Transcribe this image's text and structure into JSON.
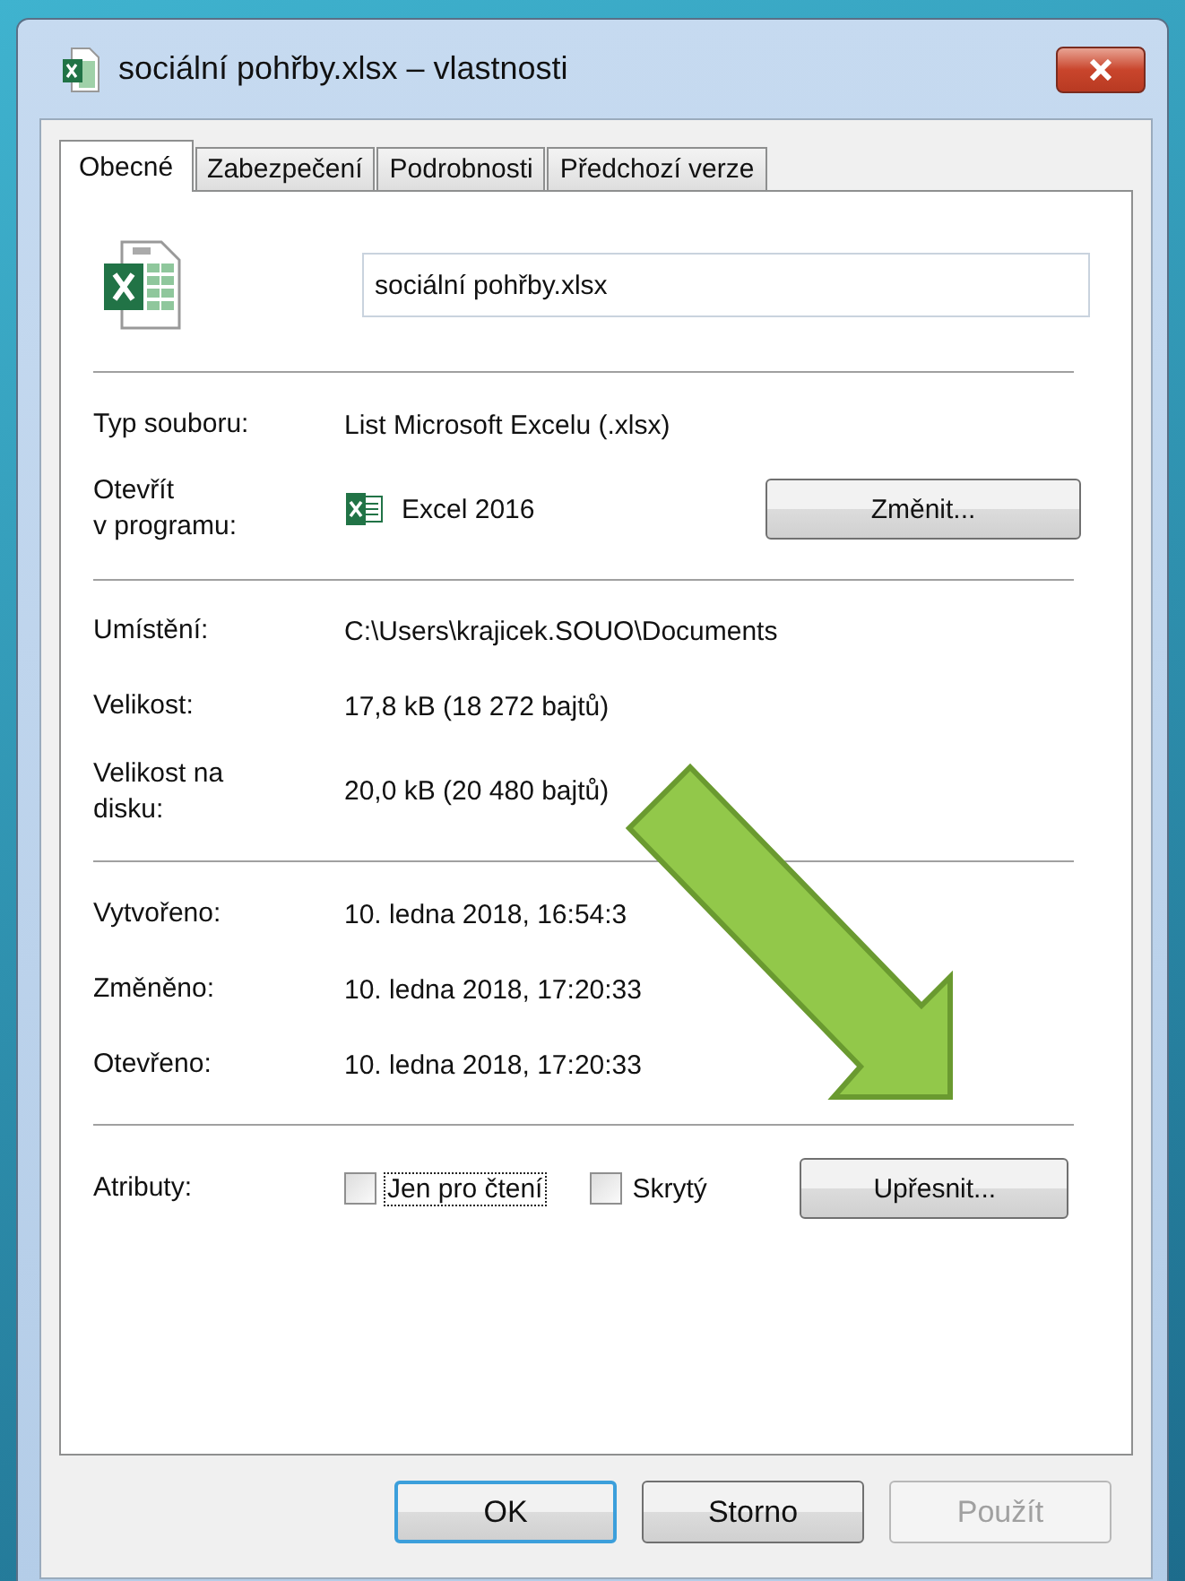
{
  "window": {
    "title": "sociální pohřby.xlsx – vlastnosti"
  },
  "tabs": [
    {
      "label": "Obecné",
      "selected": true
    },
    {
      "label": "Zabezpečení",
      "selected": false
    },
    {
      "label": "Podrobnosti",
      "selected": false
    },
    {
      "label": "Předchozí verze",
      "selected": false
    }
  ],
  "file_name": {
    "value": "sociální pohřby.xlsx"
  },
  "sections": [
    [
      {
        "kind": "text",
        "label": "Typ souboru:",
        "value": "List Microsoft Excelu (.xlsx)"
      },
      {
        "kind": "program",
        "label": "Otevřít\nv programu:",
        "value": "Excel 2016",
        "button": "Změnit..."
      }
    ],
    [
      {
        "kind": "text",
        "label": "Umístění:",
        "value": "C:\\Users\\krajicek.SOUO\\Documents"
      },
      {
        "kind": "text",
        "label": "Velikost:",
        "value": "17,8 kB (18 272 bajtů)"
      },
      {
        "kind": "text",
        "label": "Velikost na\ndisku:",
        "value": "20,0 kB (20 480 bajtů)"
      }
    ],
    [
      {
        "kind": "text",
        "label": "Vytvořeno:",
        "value": "10. ledna 2018, 16:54:3"
      },
      {
        "kind": "text",
        "label": "Změněno:",
        "value": "10. ledna 2018, 17:20:33"
      },
      {
        "kind": "text",
        "label": "Otevřeno:",
        "value": "10. ledna 2018, 17:20:33"
      }
    ]
  ],
  "attributes": {
    "label": "Atributy:",
    "checkboxes": [
      {
        "label": "Jen pro čtení",
        "checked": false,
        "focused": true
      },
      {
        "label": "Skrytý",
        "checked": false,
        "focused": false
      }
    ],
    "button": "Upřesnit..."
  },
  "buttons": [
    {
      "label": "OK",
      "default": true,
      "disabled": false
    },
    {
      "label": "Storno",
      "default": false,
      "disabled": false
    },
    {
      "label": "Použít",
      "default": false,
      "disabled": true
    }
  ]
}
